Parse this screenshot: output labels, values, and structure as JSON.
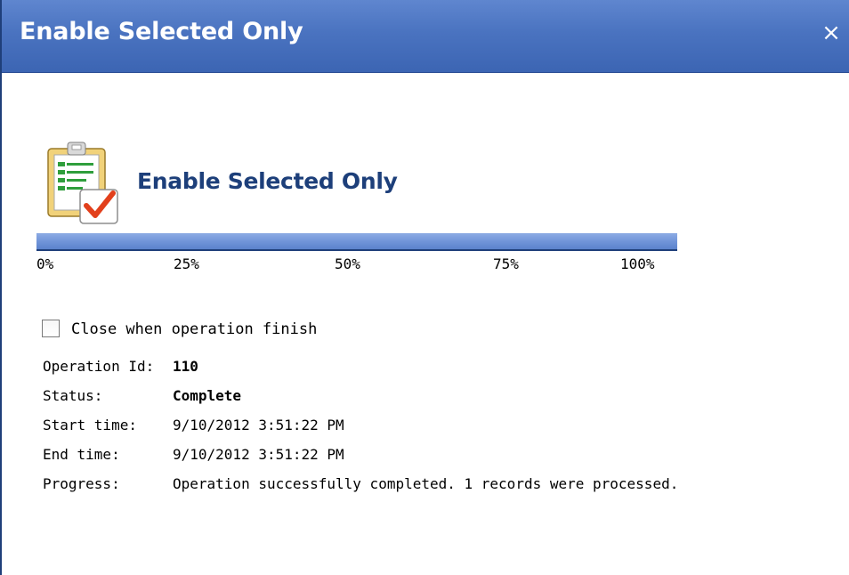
{
  "window": {
    "title": "Enable Selected Only",
    "close_symbol": "×",
    "title_bar_color": "#4a73c0"
  },
  "header": {
    "icon": "clipboard-checklist-icon",
    "title": "Enable Selected Only",
    "title_color": "#1d3f7a"
  },
  "progress": {
    "percent": 100,
    "fill_color": "#6f93d8",
    "ticks": [
      "0%",
      "25%",
      "50%",
      "75%",
      "100%"
    ]
  },
  "options": {
    "close_when_finish_label": "Close when operation finish",
    "close_when_finish_checked": false
  },
  "details": {
    "operation_id_label": "Operation Id:",
    "operation_id": "110",
    "status_label": "Status:",
    "status": "Complete",
    "start_time_label": "Start time:",
    "start_time": "9/10/2012 3:51:22 PM",
    "end_time_label": "End time:",
    "end_time": "9/10/2012 3:51:22 PM",
    "progress_label": "Progress:",
    "progress_text": "Operation successfully completed. 1 records were processed."
  }
}
